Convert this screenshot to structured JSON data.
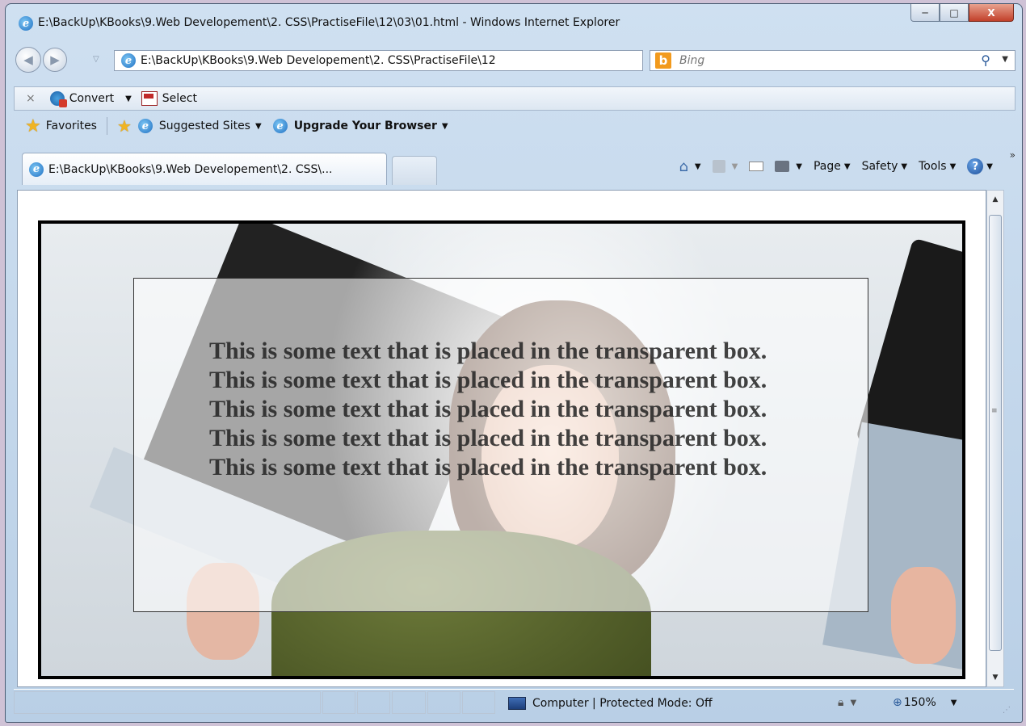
{
  "window": {
    "title": "E:\\BackUp\\KBooks\\9.Web Developement\\2. CSS\\PractiseFile\\12\\03\\01.html - Windows Internet Explorer",
    "icon": "ie-icon"
  },
  "caption": {
    "minimize": "─",
    "maximize": "□",
    "close": "X"
  },
  "address": {
    "url": "E:\\BackUp\\KBooks\\9.Web Developement\\2. CSS\\PractiseFile\\12"
  },
  "search": {
    "placeholder": "Bing",
    "logo": "b"
  },
  "command_bar": {
    "close": "×",
    "convert_label": "Convert",
    "select_label": "Select"
  },
  "favorites_bar": {
    "favorites_label": "Favorites",
    "suggested_label": "Suggested Sites",
    "upgrade_label": "Upgrade Your Browser"
  },
  "tab": {
    "label": "E:\\BackUp\\KBooks\\9.Web Developement\\2. CSS\\..."
  },
  "toolbar": {
    "page_label": "Page",
    "safety_label": "Safety",
    "tools_label": "Tools",
    "help": "?",
    "more": "»"
  },
  "content": {
    "paragraph": "This is some text that is placed in the transparent box. This is some text that is placed in the transparent box. This is some text that is placed in the transparent box. This is some text that is placed in the transparent box. This is some text that is placed in the transparent box."
  },
  "status": {
    "zone_label": "Computer | Protected Mode: Off",
    "zoom": "150%"
  },
  "colors": {
    "frame": "#4a5c73",
    "close_button": "#c2402a",
    "text_box_border": "#333333"
  }
}
